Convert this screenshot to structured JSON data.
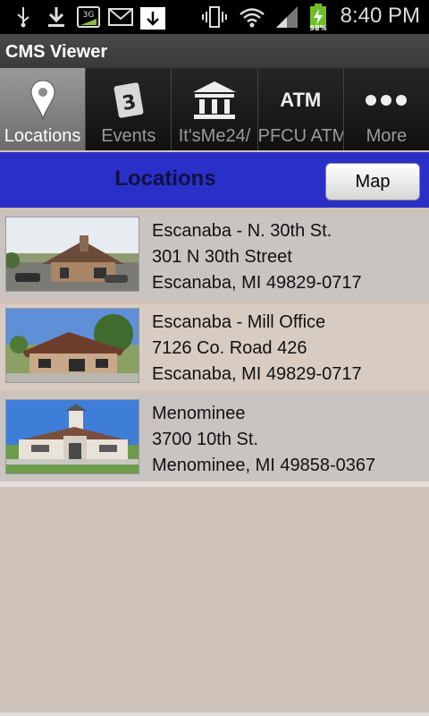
{
  "status_bar": {
    "time": "8:40 PM",
    "battery_percent": "98%",
    "network": "3G",
    "icons": [
      "usb-icon",
      "download-icon",
      "3g-data-icon",
      "email-icon",
      "download-notification-icon",
      "vibrate-icon",
      "wifi-icon",
      "signal-icon",
      "battery-charging-icon"
    ]
  },
  "app": {
    "title": "CMS Viewer"
  },
  "tabs": [
    {
      "label": "Locations",
      "icon": "location-pin-icon",
      "active": true
    },
    {
      "label": "Events",
      "icon": "calendar-icon",
      "calendar_day": "3"
    },
    {
      "label": "It'sMe24/",
      "icon": "bank-icon"
    },
    {
      "label": "PFCU ATM",
      "icon": "atm-icon",
      "icon_text": "ATM"
    },
    {
      "label": "More",
      "icon": "more-dots-icon"
    }
  ],
  "header": {
    "title": "Locations",
    "map_button": "Map"
  },
  "locations": [
    {
      "name": "Escanaba - N. 30th St.",
      "street": "301 N 30th Street",
      "city": "Escanaba, MI 49829-0717"
    },
    {
      "name": "Escanaba - Mill Office",
      "street": "7126 Co. Road 426",
      "city": "Escanaba, MI 49829-0717"
    },
    {
      "name": "Menominee",
      "street": "3700 10th St.",
      "city": "Menominee, MI 49858-0367"
    }
  ],
  "colors": {
    "header_blue": "#2a30c7",
    "background": "#cfc3b9",
    "active_tab": "#8a8a8a"
  }
}
